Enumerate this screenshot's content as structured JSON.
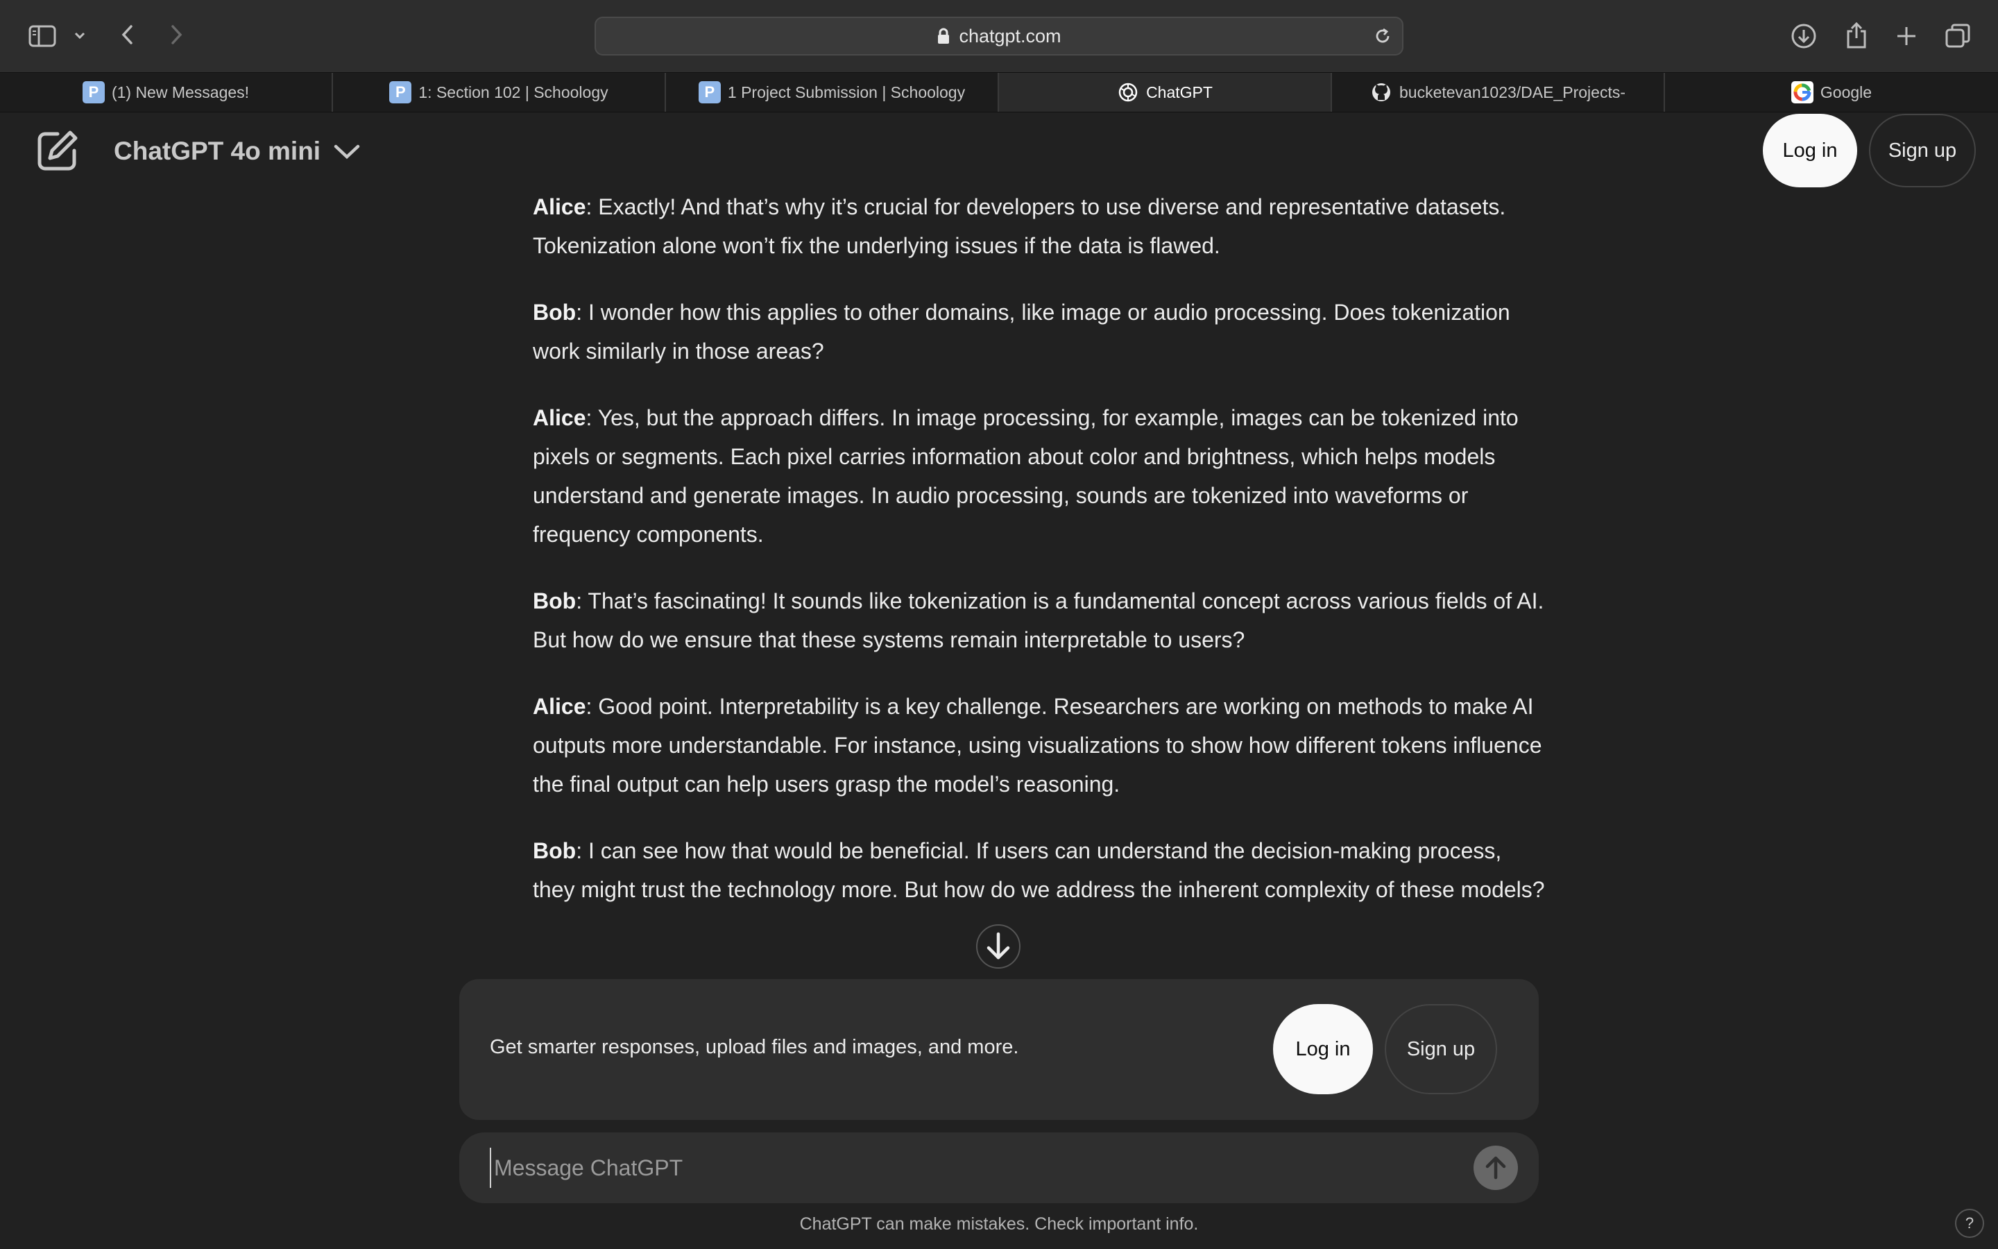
{
  "browser": {
    "url": "chatgpt.com",
    "tabs": [
      {
        "label": "(1) New Messages!",
        "icon": "schoology-icon"
      },
      {
        "label": "1: Section 102 | Schoology",
        "icon": "schoology-icon"
      },
      {
        "label": "1 Project Submission | Schoology",
        "icon": "schoology-icon"
      },
      {
        "label": "ChatGPT",
        "icon": "openai-icon",
        "active": true
      },
      {
        "label": "bucketevan1023/DAE_Projects-",
        "icon": "github-icon"
      },
      {
        "label": "Google",
        "icon": "google-icon"
      }
    ],
    "schoology_glyph": "P"
  },
  "header": {
    "model": "ChatGPT 4o mini",
    "login": "Log in",
    "signup": "Sign up"
  },
  "conversation": {
    "messages": [
      {
        "speaker": "Alice",
        "text": ": Exactly! And that’s why it’s crucial for developers to use diverse and representative datasets. Tokenization alone won’t fix the underlying issues if the data is flawed."
      },
      {
        "speaker": "Bob",
        "text": ": I wonder how this applies to other domains, like image or audio processing. Does tokenization work similarly in those areas?"
      },
      {
        "speaker": "Alice",
        "text": ": Yes, but the approach differs. In image processing, for example, images can be tokenized into pixels or segments. Each pixel carries information about color and brightness, which helps models understand and generate images. In audio processing, sounds are tokenized into waveforms or frequency components."
      },
      {
        "speaker": "Bob",
        "text": ": That’s fascinating! It sounds like tokenization is a fundamental concept across various fields of AI. But how do we ensure that these systems remain interpretable to users?"
      },
      {
        "speaker": "Alice",
        "text": ": Good point. Interpretability is a key challenge. Researchers are working on methods to make AI outputs more understandable. For instance, using visualizations to show how different tokens influence the final output can help users grasp the model’s reasoning."
      },
      {
        "speaker": "Bob",
        "text": ": I can see how that would be beneficial. If users can understand the decision-making process, they might trust the technology more. But how do we address the inherent complexity of these models?"
      }
    ]
  },
  "promo": {
    "text": "Get smarter responses, upload files and images, and more.",
    "login": "Log in",
    "signup": "Sign up"
  },
  "composer": {
    "placeholder": "Message ChatGPT"
  },
  "footer": {
    "disclaimer": "ChatGPT can make mistakes. Check important info.",
    "help": "?"
  },
  "colors": {
    "background": "#212121",
    "panel": "#2f2f2f",
    "chrome": "#2d2d2d"
  }
}
